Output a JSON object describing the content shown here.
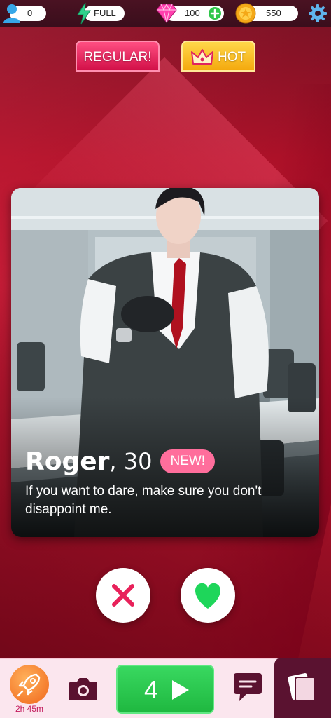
{
  "topbar": {
    "friends_count": "0",
    "energy_label": "FULL",
    "gems_count": "100",
    "coins_count": "550",
    "icons": [
      "user-icon",
      "lightning-icon",
      "diamond-icon",
      "plus-icon",
      "coin-icon",
      "gear-icon"
    ]
  },
  "tabs": {
    "regular_label": "REGULAR!",
    "hot_label": "HOT"
  },
  "profile": {
    "name": "Roger",
    "age": ", 30",
    "badge": "NEW!",
    "bio": "If you want to dare, make sure you don't disappoint me."
  },
  "actions": {
    "dislike_icon": "close-icon",
    "like_icon": "heart-icon"
  },
  "bottombar": {
    "boost_timer": "2h 45m",
    "play_count": "4",
    "icons": [
      "rocket-icon",
      "camera-icon",
      "play-icon",
      "chat-icon",
      "cards-icon"
    ]
  },
  "colors": {
    "accent_pink": "#ff6e9c",
    "regular_tab": "#e8215a",
    "hot_tab": "#f6b91a",
    "play_green": "#2cc94f",
    "like_green": "#1ed65a",
    "dislike_red": "#e8215a",
    "background_red": "#a90f26"
  }
}
